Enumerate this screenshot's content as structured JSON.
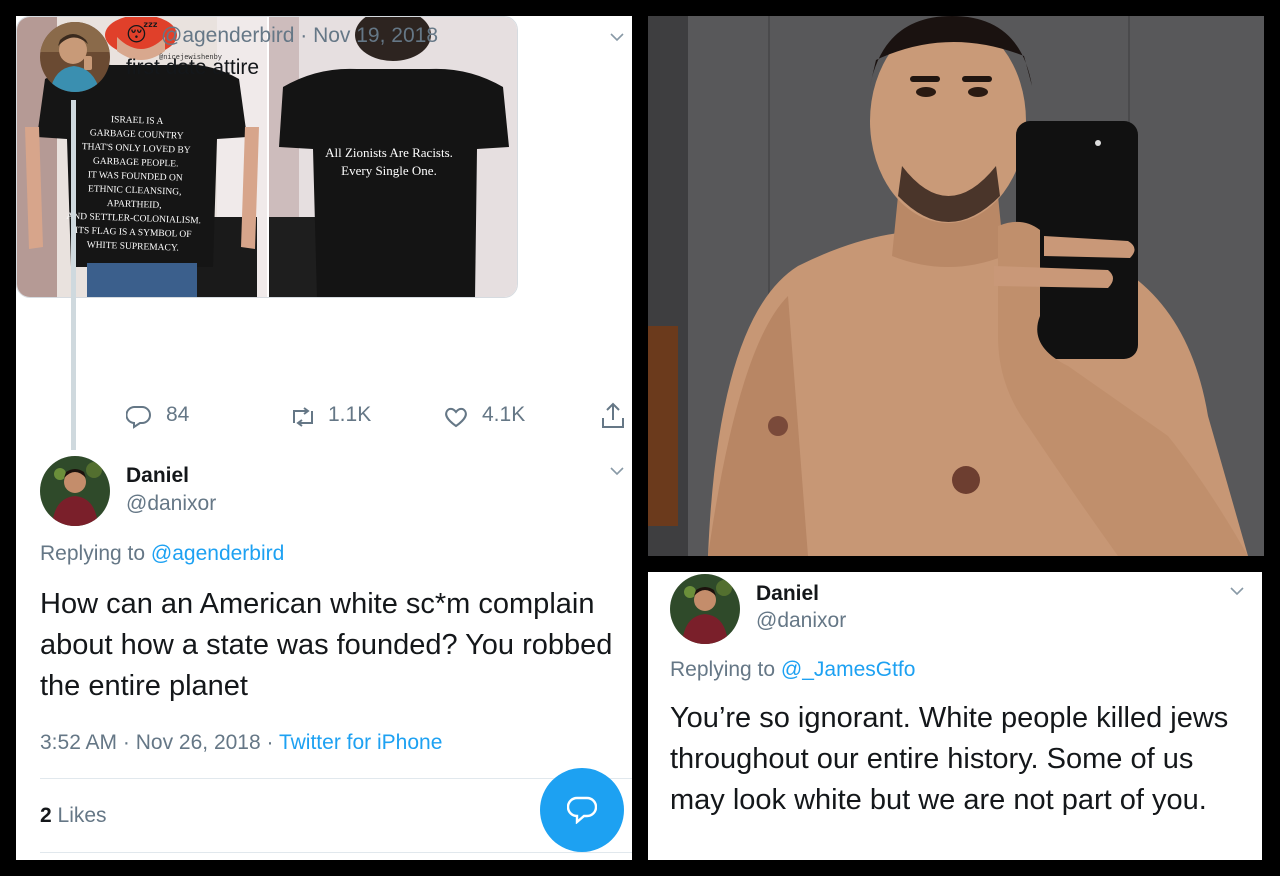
{
  "tweet_main": {
    "emoji": "😴",
    "handle": "@agenderbird",
    "separator": " · ",
    "date": "Nov 19, 2018",
    "text": "first date attire",
    "media": {
      "front_watermark": "@nicejewishenby",
      "front_shirt_lines": [
        "ISRAEL IS A",
        "GARBAGE COUNTRY",
        "THAT'S ONLY LOVED BY",
        "GARBAGE PEOPLE.",
        "IT WAS FOUNDED ON",
        "ETHNIC CLEANSING,",
        "APARTHEID,",
        "AND SETTLER-COLONIALISM.",
        "ITS FLAG IS A SYMBOL OF",
        "WHITE SUPREMACY."
      ],
      "back_shirt_lines": [
        "All Zionists Are Racists.",
        "Every Single One."
      ]
    },
    "stats": {
      "replies": "84",
      "retweets": "1.1K",
      "likes": "4.1K"
    }
  },
  "reply_left": {
    "name": "Daniel",
    "handle": "@danixor",
    "replying_prefix": "Replying to ",
    "replying_to": "@agenderbird",
    "text": "How can an American white sc*m complain about how a state was founded? You robbed the entire planet",
    "time": "3:52 AM",
    "separator": " · ",
    "date": "Nov 26, 2018",
    "source": "Twitter for iPhone",
    "likes_count": "2",
    "likes_label": "Likes"
  },
  "reply_right": {
    "name": "Daniel",
    "handle": "@danixor",
    "replying_prefix": "Replying to ",
    "replying_to": "@_JamesGtfo",
    "text": "You’re so ignorant. White people killed jews throughout our entire history. Some of us may look white but we are not part of you."
  },
  "colors": {
    "accent": "#1da1f2",
    "muted": "#657786",
    "thread_line": "#cfd9de",
    "text": "#14171a"
  },
  "icons": [
    "reply-icon",
    "retweet-icon",
    "like-icon",
    "share-icon",
    "chevron-down-icon",
    "compose-reply-icon",
    "sleepy-emoji-icon"
  ]
}
